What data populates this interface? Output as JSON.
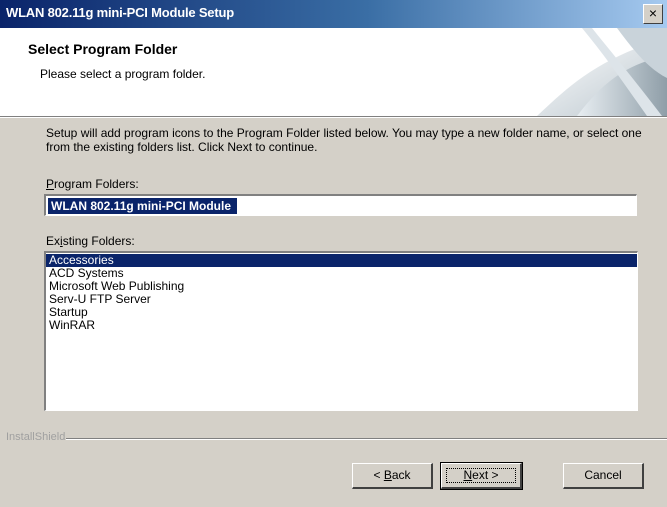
{
  "window": {
    "title": "WLAN 802.11g mini-PCI Module Setup",
    "close_glyph": "×"
  },
  "header": {
    "title": "Select Program Folder",
    "subtitle": "Please select a program folder."
  },
  "instructions": "Setup will add program icons to the Program Folder listed below.  You may type a new folder name, or select one from the existing folders list.  Click Next to continue.",
  "program_folder": {
    "label_mnemonic": "P",
    "label_rest": "rogram Folders:",
    "value": "WLAN 802.11g mini-PCI Module"
  },
  "existing_folders": {
    "label_first": "Ex",
    "label_mnemonic": "i",
    "label_rest": "sting Folders:",
    "items": [
      {
        "label": "Accessories",
        "selected": true
      },
      {
        "label": "ACD Systems",
        "selected": false
      },
      {
        "label": "Microsoft Web Publishing",
        "selected": false
      },
      {
        "label": "Serv-U FTP Server",
        "selected": false
      },
      {
        "label": "Startup",
        "selected": false
      },
      {
        "label": "WinRAR",
        "selected": false
      }
    ]
  },
  "footer": {
    "brand": "InstallShield"
  },
  "buttons": {
    "back_prefix": "< ",
    "back_mnemonic": "B",
    "back_rest": "ack",
    "next_mnemonic": "N",
    "next_rest": "ext >",
    "cancel": "Cancel"
  },
  "colors": {
    "title_bar": "#0a246a",
    "selection": "#0a246a",
    "dialog_face": "#d4d0c8"
  },
  "icons": [
    "close-icon",
    "header-swoosh-graphic"
  ]
}
